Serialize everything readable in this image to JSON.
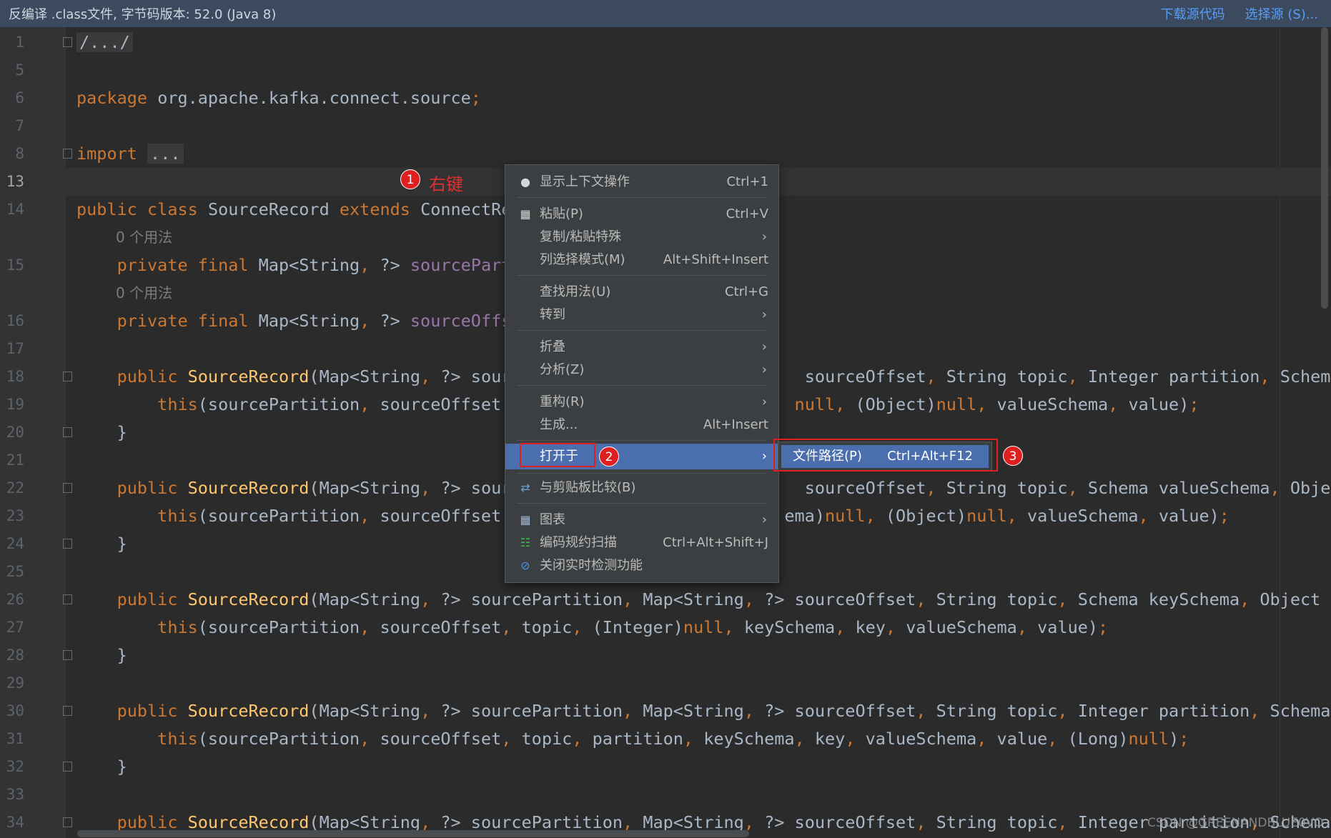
{
  "banner": {
    "text": "反编译 .class文件, 字节码版本: 52.0 (Java 8)",
    "download_source": "下载源代码",
    "choose_source": "选择源 (S)..."
  },
  "code": {
    "lines": [
      {
        "num": "1",
        "segments": [
          {
            "t": "/.../",
            "c": "fold-box"
          }
        ]
      },
      {
        "num": "5",
        "segments": []
      },
      {
        "num": "6",
        "segments": [
          {
            "t": "package ",
            "c": "kw"
          },
          {
            "t": "org.apache.kafka.connect.source"
          },
          {
            "t": ";",
            "c": "kw"
          }
        ]
      },
      {
        "num": "7",
        "segments": []
      },
      {
        "num": "8",
        "segments": [
          {
            "t": "import ",
            "c": "kw"
          },
          {
            "t": "...",
            "c": "fold-box"
          }
        ]
      },
      {
        "num": "13",
        "segments": []
      },
      {
        "num": "14",
        "segments": [
          {
            "t": "public class ",
            "c": "kw"
          },
          {
            "t": "SourceRecord "
          },
          {
            "t": "extends ",
            "c": "kw"
          },
          {
            "t": "ConnectRe"
          }
        ]
      },
      {
        "num": "15",
        "segments": [
          {
            "t": "    private final ",
            "c": "kw"
          },
          {
            "t": "Map<String"
          },
          {
            "t": ", ",
            "c": "kw"
          },
          {
            "t": "?> "
          },
          {
            "t": "sourcePart",
            "c": "fld"
          }
        ]
      },
      {
        "num": "16",
        "segments": [
          {
            "t": "    private final ",
            "c": "kw"
          },
          {
            "t": "Map<String"
          },
          {
            "t": ", ",
            "c": "kw"
          },
          {
            "t": "?> "
          },
          {
            "t": "sourceOffs",
            "c": "fld"
          }
        ]
      },
      {
        "num": "17",
        "segments": []
      },
      {
        "num": "18",
        "segments": [
          {
            "t": "    public ",
            "c": "kw"
          },
          {
            "t": "SourceRecord",
            "c": "fn"
          },
          {
            "t": "(Map<String"
          },
          {
            "t": ", ",
            "c": "kw"
          },
          {
            "t": "?> sour                             sourceOffset"
          },
          {
            "t": ", ",
            "c": "kw"
          },
          {
            "t": "String topic"
          },
          {
            "t": ", ",
            "c": "kw"
          },
          {
            "t": "Integer partition"
          },
          {
            "t": ", ",
            "c": "kw"
          },
          {
            "t": "Schema v"
          }
        ]
      },
      {
        "num": "19",
        "segments": [
          {
            "t": "        this",
            "c": "kw"
          },
          {
            "t": "(sourcePartition"
          },
          {
            "t": ", ",
            "c": "kw"
          },
          {
            "t": "sourceOffset"
          },
          {
            "t": ",                            ",
            "c": "kw"
          },
          {
            "t": "null",
            "c": "kw"
          },
          {
            "t": ", ",
            "c": "kw"
          },
          {
            "t": "(Object)"
          },
          {
            "t": "null",
            "c": "kw"
          },
          {
            "t": ", ",
            "c": "kw"
          },
          {
            "t": "valueSchema"
          },
          {
            "t": ", ",
            "c": "kw"
          },
          {
            "t": "value)"
          },
          {
            "t": ";",
            "c": "kw"
          }
        ]
      },
      {
        "num": "20",
        "segments": [
          {
            "t": "    }"
          }
        ]
      },
      {
        "num": "21",
        "segments": []
      },
      {
        "num": "22",
        "segments": [
          {
            "t": "    public ",
            "c": "kw"
          },
          {
            "t": "SourceRecord",
            "c": "fn"
          },
          {
            "t": "(Map<String"
          },
          {
            "t": ", ",
            "c": "kw"
          },
          {
            "t": "?> sour                             sourceOffset"
          },
          {
            "t": ", ",
            "c": "kw"
          },
          {
            "t": "String topic"
          },
          {
            "t": ", ",
            "c": "kw"
          },
          {
            "t": "Schema valueSchema"
          },
          {
            "t": ", ",
            "c": "kw"
          },
          {
            "t": "Object"
          }
        ]
      },
      {
        "num": "23",
        "segments": [
          {
            "t": "        this",
            "c": "kw"
          },
          {
            "t": "(sourcePartition"
          },
          {
            "t": ", ",
            "c": "kw"
          },
          {
            "t": "sourceOffset"
          },
          {
            "t": ",                           ",
            "c": "kw"
          },
          {
            "t": "ema)"
          },
          {
            "t": "null",
            "c": "kw"
          },
          {
            "t": ", ",
            "c": "kw"
          },
          {
            "t": "(Object)"
          },
          {
            "t": "null",
            "c": "kw"
          },
          {
            "t": ", ",
            "c": "kw"
          },
          {
            "t": "valueSchema"
          },
          {
            "t": ", ",
            "c": "kw"
          },
          {
            "t": "value)"
          },
          {
            "t": ";",
            "c": "kw"
          }
        ]
      },
      {
        "num": "24",
        "segments": [
          {
            "t": "    }"
          }
        ]
      },
      {
        "num": "25",
        "segments": []
      },
      {
        "num": "26",
        "segments": [
          {
            "t": "    public ",
            "c": "kw"
          },
          {
            "t": "SourceRecord",
            "c": "fn"
          },
          {
            "t": "(Map<String"
          },
          {
            "t": ", ",
            "c": "kw"
          },
          {
            "t": "?> sourcePartition"
          },
          {
            "t": ", ",
            "c": "kw"
          },
          {
            "t": "Map<String"
          },
          {
            "t": ", ",
            "c": "kw"
          },
          {
            "t": "?> sourceOffset"
          },
          {
            "t": ", ",
            "c": "kw"
          },
          {
            "t": "String topic"
          },
          {
            "t": ", ",
            "c": "kw"
          },
          {
            "t": "Schema keySchema"
          },
          {
            "t": ", ",
            "c": "kw"
          },
          {
            "t": "Object ke"
          }
        ]
      },
      {
        "num": "27",
        "segments": [
          {
            "t": "        this",
            "c": "kw"
          },
          {
            "t": "(sourcePartition"
          },
          {
            "t": ", ",
            "c": "kw"
          },
          {
            "t": "sourceOffset"
          },
          {
            "t": ", ",
            "c": "kw"
          },
          {
            "t": "topic"
          },
          {
            "t": ", ",
            "c": "kw"
          },
          {
            "t": "(Integer)"
          },
          {
            "t": "null",
            "c": "kw"
          },
          {
            "t": ", ",
            "c": "kw"
          },
          {
            "t": "keySchema"
          },
          {
            "t": ", ",
            "c": "kw"
          },
          {
            "t": "key"
          },
          {
            "t": ", ",
            "c": "kw"
          },
          {
            "t": "valueSchema"
          },
          {
            "t": ", ",
            "c": "kw"
          },
          {
            "t": "value)"
          },
          {
            "t": ";",
            "c": "kw"
          }
        ]
      },
      {
        "num": "28",
        "segments": [
          {
            "t": "    }"
          }
        ]
      },
      {
        "num": "29",
        "segments": []
      },
      {
        "num": "30",
        "segments": [
          {
            "t": "    public ",
            "c": "kw"
          },
          {
            "t": "SourceRecord",
            "c": "fn"
          },
          {
            "t": "(Map<String"
          },
          {
            "t": ", ",
            "c": "kw"
          },
          {
            "t": "?> sourcePartition"
          },
          {
            "t": ", ",
            "c": "kw"
          },
          {
            "t": "Map<String"
          },
          {
            "t": ", ",
            "c": "kw"
          },
          {
            "t": "?> sourceOffset"
          },
          {
            "t": ", ",
            "c": "kw"
          },
          {
            "t": "String topic"
          },
          {
            "t": ", ",
            "c": "kw"
          },
          {
            "t": "Integer partition"
          },
          {
            "t": ", ",
            "c": "kw"
          },
          {
            "t": "Schema k"
          }
        ]
      },
      {
        "num": "31",
        "segments": [
          {
            "t": "        this",
            "c": "kw"
          },
          {
            "t": "(sourcePartition"
          },
          {
            "t": ", ",
            "c": "kw"
          },
          {
            "t": "sourceOffset"
          },
          {
            "t": ", ",
            "c": "kw"
          },
          {
            "t": "topic"
          },
          {
            "t": ", ",
            "c": "kw"
          },
          {
            "t": "partition"
          },
          {
            "t": ", ",
            "c": "kw"
          },
          {
            "t": "keySchema"
          },
          {
            "t": ", ",
            "c": "kw"
          },
          {
            "t": "key"
          },
          {
            "t": ", ",
            "c": "kw"
          },
          {
            "t": "valueSchema"
          },
          {
            "t": ", ",
            "c": "kw"
          },
          {
            "t": "value"
          },
          {
            "t": ", ",
            "c": "kw"
          },
          {
            "t": "(Long)"
          },
          {
            "t": "null",
            "c": "kw"
          },
          {
            "t": ")"
          },
          {
            "t": ";",
            "c": "kw"
          }
        ]
      },
      {
        "num": "32",
        "segments": [
          {
            "t": "    }"
          }
        ]
      },
      {
        "num": "33",
        "segments": []
      },
      {
        "num": "34",
        "segments": [
          {
            "t": "    public ",
            "c": "kw"
          },
          {
            "t": "SourceRecord",
            "c": "fn"
          },
          {
            "t": "(Map<String"
          },
          {
            "t": ", ",
            "c": "kw"
          },
          {
            "t": "?> sourcePartition"
          },
          {
            "t": ", ",
            "c": "kw"
          },
          {
            "t": "Map<String"
          },
          {
            "t": ", ",
            "c": "kw"
          },
          {
            "t": "?> sourceOffset"
          },
          {
            "t": ", ",
            "c": "kw"
          },
          {
            "t": "String topic"
          },
          {
            "t": ", ",
            "c": "kw"
          },
          {
            "t": "Integer partition"
          },
          {
            "t": ", ",
            "c": "kw"
          },
          {
            "t": "Schema k"
          }
        ]
      }
    ],
    "usage_hint_1": "0 个用法",
    "usage_hint_2": "0 个用法"
  },
  "annotations": {
    "marker1": "1",
    "marker1_label": "右键",
    "marker2": "2",
    "marker3": "3"
  },
  "context_menu": {
    "items": [
      {
        "label": "显示上下文操作",
        "shortcut": "Ctrl+1",
        "icon": "bulb-icon"
      },
      {
        "label": "粘贴(P)",
        "shortcut": "Ctrl+V",
        "icon": "clipboard-icon"
      },
      {
        "label": "复制/粘贴特殊",
        "submenu": true
      },
      {
        "label": "列选择模式(M)",
        "shortcut": "Alt+Shift+Insert"
      },
      {
        "label": "查找用法(U)",
        "shortcut": "Ctrl+G"
      },
      {
        "label": "转到",
        "submenu": true
      },
      {
        "label": "折叠",
        "submenu": true
      },
      {
        "label": "分析(Z)",
        "submenu": true
      },
      {
        "label": "重构(R)",
        "submenu": true
      },
      {
        "label": "生成...",
        "shortcut": "Alt+Insert"
      },
      {
        "label": "打开于",
        "submenu": true,
        "selected": true
      },
      {
        "label": "与剪贴板比较(B)",
        "icon": "compare-icon"
      },
      {
        "label": "图表",
        "submenu": true,
        "icon": "diagram-icon"
      },
      {
        "label": "编码规约扫描",
        "shortcut": "Ctrl+Alt+Shift+J",
        "icon": "scan-icon"
      },
      {
        "label": "关闭实时检测功能",
        "icon": "disable-icon"
      }
    ]
  },
  "submenu": {
    "label": "文件路径(P)",
    "shortcut": "Ctrl+Alt+F12"
  },
  "watermark": "CSDN @GREENANDBLUE0VO"
}
